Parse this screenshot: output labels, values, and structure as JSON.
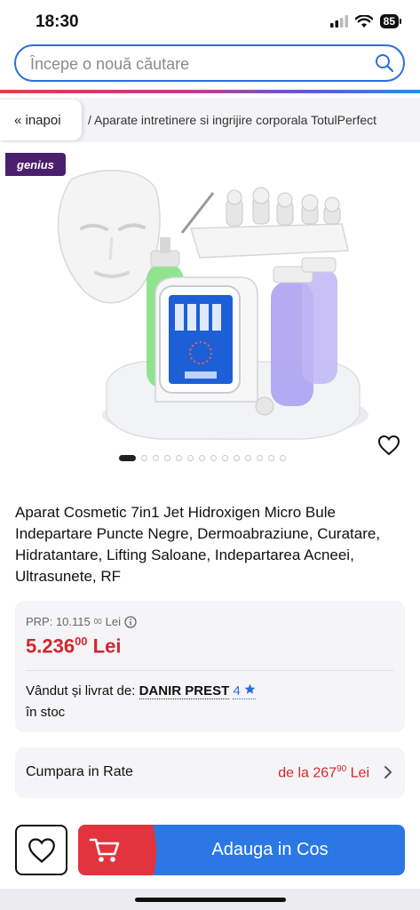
{
  "status_bar": {
    "time": "18:30",
    "battery": "85"
  },
  "search": {
    "placeholder": "Începe o nouă căutare"
  },
  "breadcrumb": {
    "back_label": "« inapoi",
    "path": "/  Aparate intretinere si ingrijire corporala TotulPerfect"
  },
  "gallery": {
    "badge": "genius",
    "image_count": 14,
    "active_index": 0
  },
  "product": {
    "title": "Aparat Cosmetic 7in1 Jet Hidroxigen Micro Bule Indepartare Puncte Negre, Dermoabraziune, Curatare, Hidratantare, Lifting Saloane, Indepartarea Acneei, Ultrasunete, RF"
  },
  "pricing": {
    "rrp_label": "PRP: 10.115",
    "rrp_decimals": "00",
    "rrp_currency": "Lei",
    "price_main": "5.236",
    "price_decimals": "00",
    "price_currency": "Lei"
  },
  "seller": {
    "label": "Vândut și livrat de:",
    "name": "DANIR PREST",
    "rating": "4",
    "stock": "în stoc"
  },
  "installments": {
    "label": "Cumpara in Rate",
    "prefix": "de la 267",
    "decimals": "90",
    "currency": "Lei"
  },
  "actions": {
    "add_to_cart": "Adauga in Cos"
  },
  "colors": {
    "accent_blue": "#2b78e4",
    "price_red": "#d5252e",
    "genius_purple": "#4a1f6e"
  }
}
